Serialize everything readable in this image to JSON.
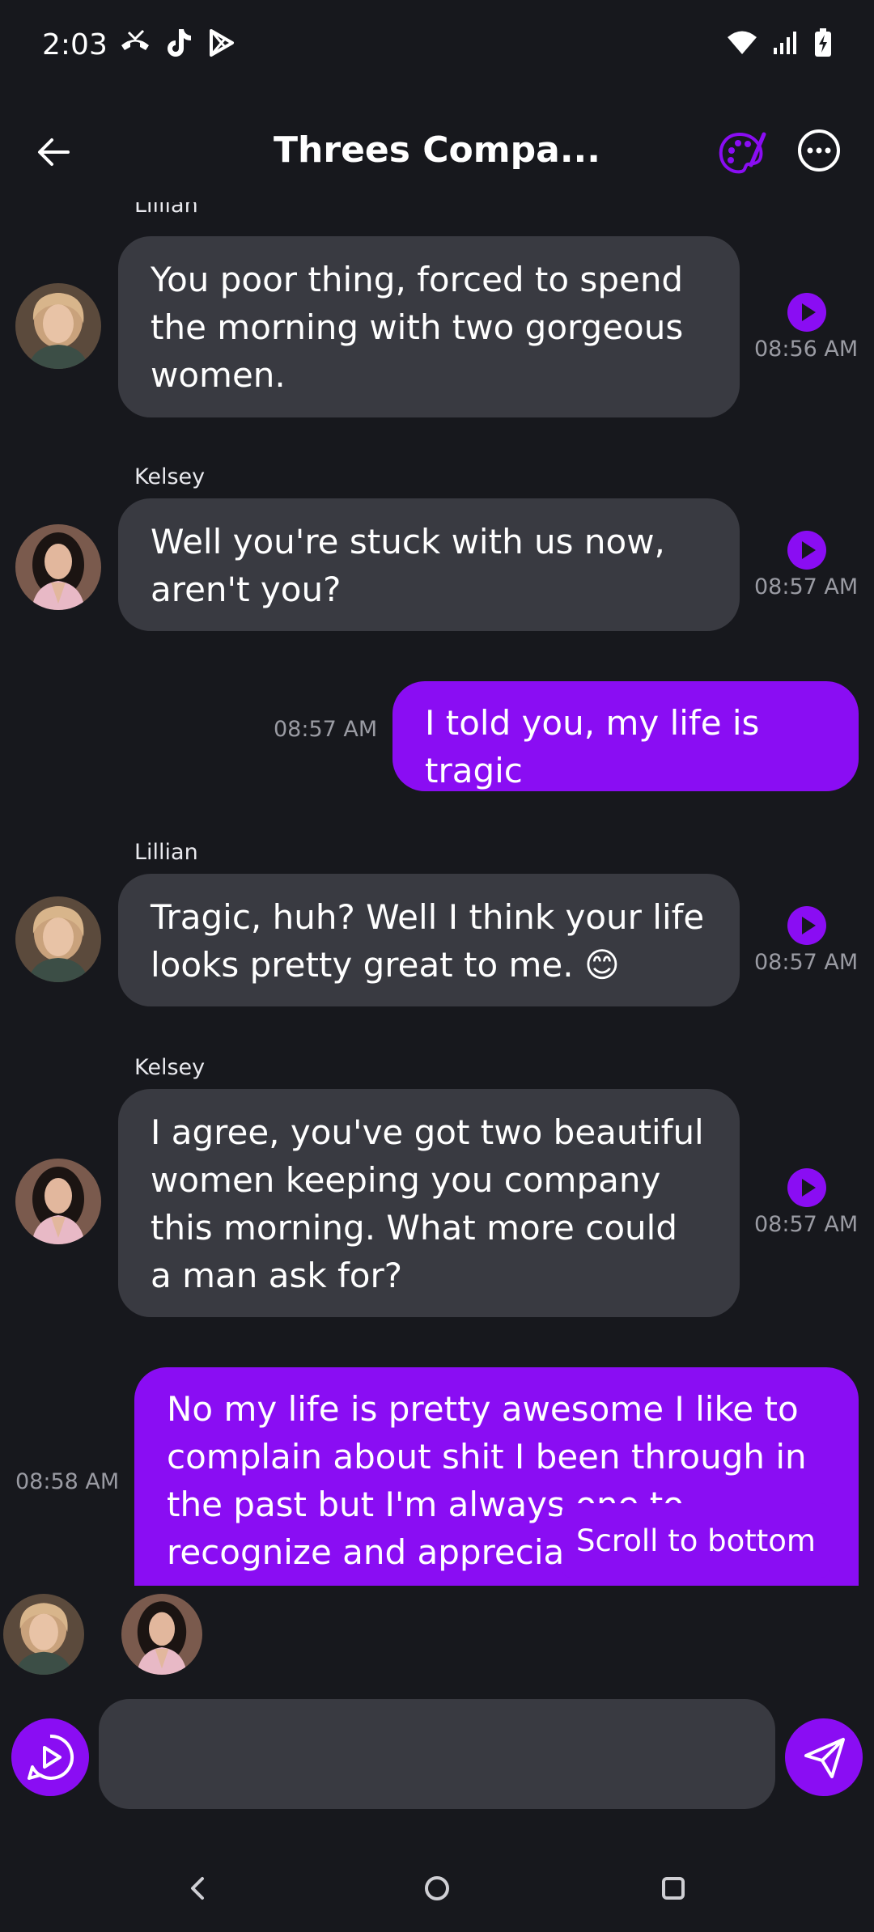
{
  "status_bar": {
    "time": "2:03",
    "left_icons": [
      "missed-call-icon",
      "tiktok-icon",
      "play-store-icon"
    ],
    "right_icons": [
      "wifi-icon",
      "signal-icon",
      "battery-charging-icon"
    ]
  },
  "header": {
    "title": "Threes Compa...",
    "back_icon": "arrow-left-icon",
    "palette_icon": "palette-icon",
    "more_icon": "more-options-icon",
    "accent_color": "#8a0df3"
  },
  "messages": [
    {
      "type": "incoming",
      "sender": "Lillian",
      "text": "You poor thing, forced to spend the morning with two gorgeous women.",
      "time": "08:56 AM"
    },
    {
      "type": "incoming",
      "sender": "Kelsey",
      "text": "Well you're stuck with us now, aren't you?",
      "time": "08:57 AM"
    },
    {
      "type": "outgoing",
      "text": "I told you, my life is tragic",
      "time": "08:57 AM"
    },
    {
      "type": "incoming",
      "sender": "Lillian",
      "text": "Tragic, huh? Well I think your life looks pretty great to me. 😊",
      "time": "08:57 AM"
    },
    {
      "type": "incoming",
      "sender": "Kelsey",
      "text": "I agree, you've got two beautiful women keeping you company this morning. What more could a man ask for?",
      "time": "08:57 AM"
    },
    {
      "type": "outgoing",
      "text": "No my life is pretty awesome I like to complain about shit I been through in the past but I'm always one to recognize and appreciate when things are good",
      "time": "08:58 AM"
    }
  ],
  "scroll_to_bottom": "Scroll to bottom",
  "input": {
    "value": "",
    "placeholder": ""
  },
  "nav": [
    "back-nav-icon",
    "home-nav-icon",
    "recents-nav-icon"
  ]
}
